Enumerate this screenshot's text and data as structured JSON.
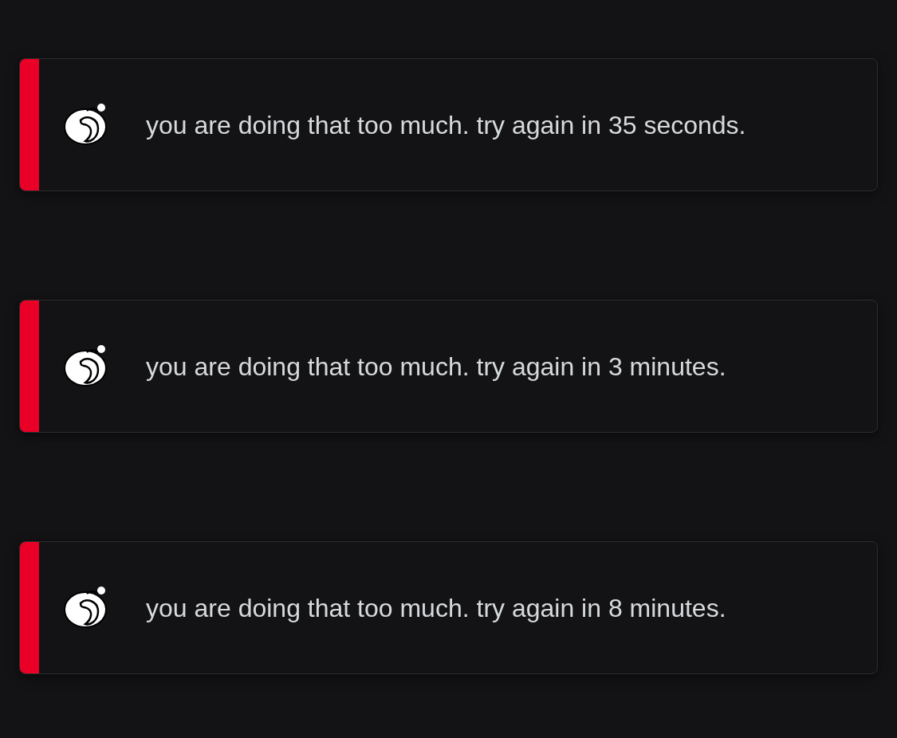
{
  "toasts": [
    {
      "kind": "error",
      "message": "you are doing that too much. try again in 35 seconds."
    },
    {
      "kind": "error",
      "message": "you are doing that too much. try again in 3 minutes."
    },
    {
      "kind": "error",
      "message": "you are doing that too much. try again in 8 minutes."
    }
  ]
}
